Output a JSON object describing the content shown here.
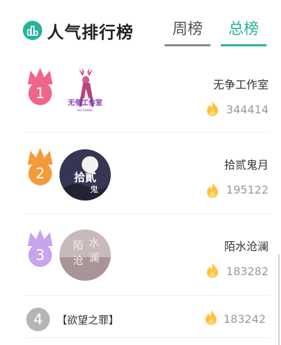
{
  "header": {
    "title": "人气排行榜",
    "tabs": [
      {
        "label": "周榜",
        "active": false
      },
      {
        "label": "总榜",
        "active": true
      }
    ],
    "accent_color": "#26b39a"
  },
  "ranking": [
    {
      "rank": "1",
      "name": "无争工作室",
      "score": "344414",
      "avatar_text": "无争工作室",
      "avatar_sub": "WU ZHENG",
      "color": "#f0668a"
    },
    {
      "rank": "2",
      "name": "拾贰鬼月",
      "score": "195122",
      "avatar_text": "拾贰鬼月",
      "color": "#f59a3a"
    },
    {
      "rank": "3",
      "name": "陌水沧澜",
      "score": "183282",
      "avatar_text": "陌水沧澜",
      "color": "#c7a4ec"
    },
    {
      "rank": "4",
      "name": "【欲望之罪】",
      "score": "183242",
      "color": "#b5b5b5"
    }
  ],
  "icons": {
    "logo": "bar-chart-icon",
    "score": "fire-icon",
    "rank_badge": "crown-icon"
  }
}
